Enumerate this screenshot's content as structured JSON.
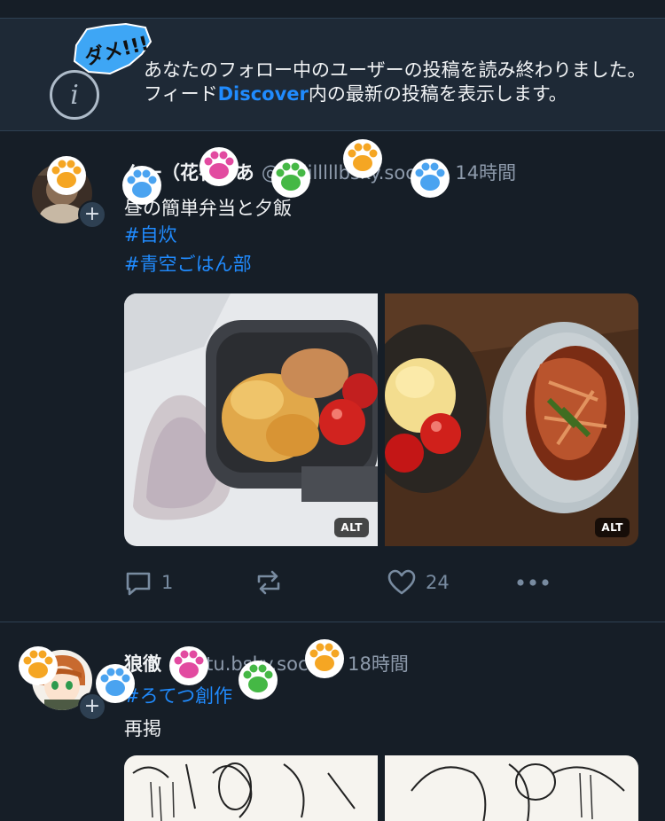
{
  "banner": {
    "text_before": "あなたのフォロー中のユーザーの投稿を読み終わりました。フィード",
    "link": "Discover",
    "text_after": "内の最新の投稿を表示します。",
    "sticker_text": "ダメ!!!"
  },
  "icons": {
    "info": "info-icon",
    "add": "plus-icon",
    "reply": "speech-bubble-icon",
    "repost": "repost-arrows-icon",
    "like": "heart-icon",
    "more": "ellipsis-icon",
    "paw": "cat-paw-sticker-icon"
  },
  "posts": [
    {
      "author": "ん一（花花であ",
      "handle": "@hiiiilllllbsky.social",
      "separator": "·",
      "time": "14時間",
      "text": "昼の簡単弁当と夕飯",
      "tags": [
        "#自炊",
        "#青空ごはん部"
      ],
      "images": [
        {
          "alt_badge": "ALT",
          "subject": "bento-rice-ball-eggs-tomatoes"
        },
        {
          "alt_badge": "ALT",
          "subject": "stir-fry-potato-salad-tomatoes"
        }
      ],
      "replies": "1",
      "likes": "24",
      "avatar_add": "+"
    },
    {
      "author": "狼徹",
      "handle": "rotetu.bsky.social",
      "separator": "·",
      "time": "18時間",
      "tags": [
        "#ろてつ創作"
      ],
      "text": "再掲",
      "images": [
        {
          "subject": "manga-sketch-1"
        },
        {
          "subject": "manga-sketch-2"
        }
      ],
      "avatar_add": "+"
    }
  ],
  "colors": {
    "background": "#161e27",
    "banner_bg": "#1e2936",
    "link": "#208bfe",
    "muted": "#8d9aab",
    "paw_orange": "#f5a623",
    "paw_blue": "#4aa3f0",
    "paw_pink": "#e24aa0",
    "paw_green": "#45b845"
  }
}
